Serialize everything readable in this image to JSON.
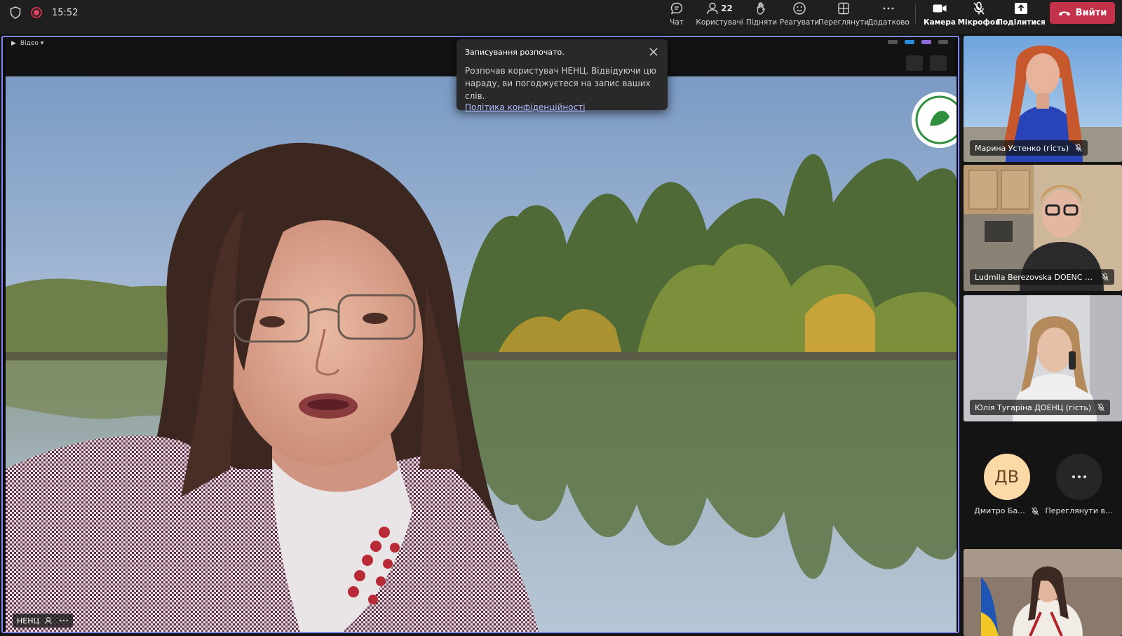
{
  "header": {
    "time": "15:52",
    "buttons": {
      "chat": "Чат",
      "people": "Користувачі",
      "people_count": "22",
      "raise": "Підняти",
      "react": "Реагувати",
      "view": "Переглянути",
      "more": "Додатково",
      "camera": "Камера",
      "mic": "Мікрофон",
      "share": "Поділитися",
      "leave": "Вийти"
    },
    "colors": {
      "leave": "#c4314b",
      "recording": "#e0455f"
    }
  },
  "stage": {
    "inner_label": "Відео ▾",
    "speaker_name": "НЕНЦ",
    "active_border": "#7f85f5"
  },
  "toast": {
    "title": "Записування розпочато.",
    "body": "Розпочав користувач НЕНЦ. Відвідуючи цю нараду, ви погоджуєтеся на запис ваших слів.",
    "link": "Політика конфіденційності"
  },
  "participants": [
    {
      "name": "Марина Устенко (гість)",
      "muted": true
    },
    {
      "name": "Ludmila Berezovska DOENC (гість)",
      "muted": true
    },
    {
      "name": "Юлія Тугаріна ДОЕНЦ (гість)",
      "muted": true
    },
    {
      "name": "Дмитро Ба...",
      "initials": "ДВ",
      "muted": true
    },
    {
      "name": "Переглянути в..."
    }
  ]
}
